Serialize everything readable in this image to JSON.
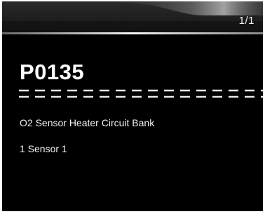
{
  "header": {
    "page_indicator": "1/1"
  },
  "dtc": {
    "code": "P0135",
    "description_lines": [
      "O2 Sensor Heater Circuit Bank",
      "1 Sensor 1"
    ]
  },
  "colors": {
    "background": "#000000",
    "text": "#ffffff",
    "header": "#222222"
  }
}
